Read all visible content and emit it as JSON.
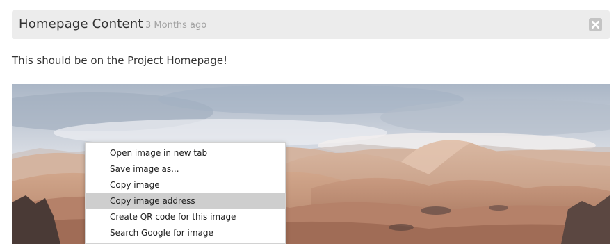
{
  "header": {
    "title": "Homepage Content",
    "age": "3 Months ago"
  },
  "content": {
    "text": "This should be on the Project Homepage!"
  },
  "icons": {
    "close": "close-x-icon"
  },
  "context_menu": {
    "items": [
      {
        "label": "Open image in new tab"
      },
      {
        "label": "Save image as..."
      },
      {
        "label": "Copy image"
      },
      {
        "label": "Copy image address",
        "highlighted": true
      },
      {
        "label": "Create QR code for this image"
      },
      {
        "label": "Search Google for image"
      }
    ]
  }
}
